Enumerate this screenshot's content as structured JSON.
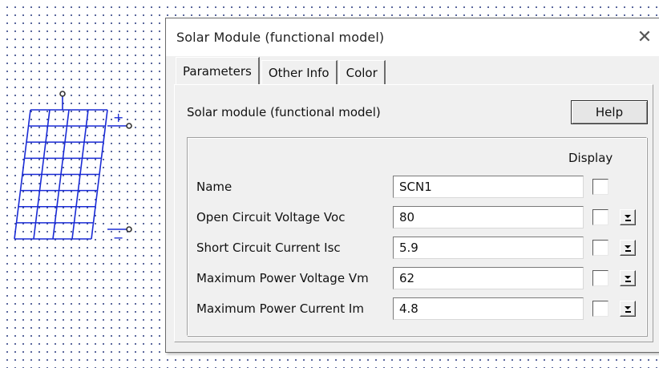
{
  "dialog": {
    "title": "Solar Module (functional model)",
    "close_glyph": "✕"
  },
  "tabs": [
    {
      "label": "Parameters",
      "active": true
    },
    {
      "label": "Other Info",
      "active": false
    },
    {
      "label": "Color",
      "active": false
    }
  ],
  "module_label": "Solar module (functional model)",
  "help_label": "Help",
  "display_header": "Display",
  "params": [
    {
      "label": "Name",
      "value": "SCN1",
      "display_checked": false,
      "has_dropdown": false
    },
    {
      "label": "Open Circuit Voltage Voc",
      "value": "80",
      "display_checked": false,
      "has_dropdown": true
    },
    {
      "label": "Short Circuit Current Isc",
      "value": "5.9",
      "display_checked": false,
      "has_dropdown": true
    },
    {
      "label": "Maximum Power Voltage Vm",
      "value": "62",
      "display_checked": false,
      "has_dropdown": true
    },
    {
      "label": "Maximum Power Current Im",
      "value": "4.8",
      "display_checked": false,
      "has_dropdown": true
    }
  ],
  "symbol": {
    "plus_label": "+",
    "minus_label": "−",
    "color": "#1a2bd6"
  }
}
